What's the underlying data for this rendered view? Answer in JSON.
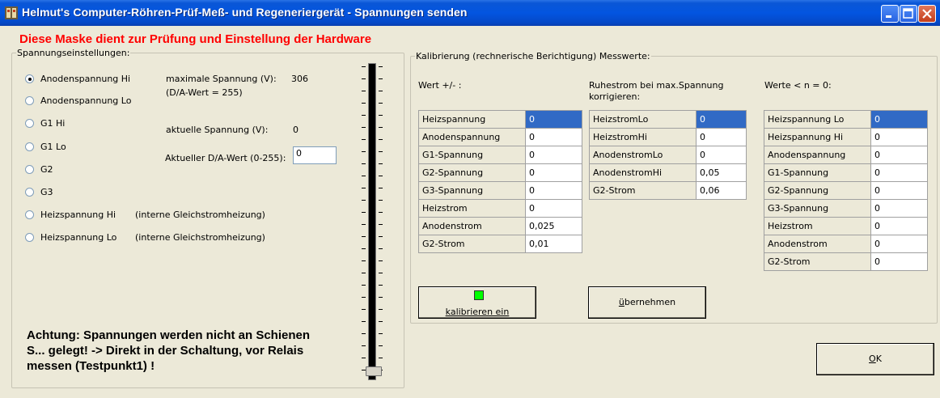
{
  "window": {
    "title": "Helmut's Computer-Röhren-Prüf-Meß- und Regeneriergerät - Spannungen senden"
  },
  "header_warning": "Diese Maske dient zur Prüfung und Einstellung der Hardware",
  "voltage_group": {
    "legend": "Spannungseinstellungen:",
    "options": [
      {
        "label": "Anodenspannung Hi",
        "selected": true
      },
      {
        "label": "Anodenspannung Lo",
        "selected": false
      },
      {
        "label": "G1 Hi",
        "selected": false
      },
      {
        "label": "G1 Lo",
        "selected": false
      },
      {
        "label": "G2",
        "selected": false
      },
      {
        "label": "G3",
        "selected": false
      },
      {
        "label": "Heizspannung Hi",
        "selected": false
      },
      {
        "label": "Heizspannung Lo",
        "selected": false
      }
    ],
    "heater_note_hi": "(interne Gleichstromheizung)",
    "heater_note_lo": "(interne Gleichstromheizung)",
    "max_voltage_label": "maximale Spannung (V):",
    "max_voltage_value": "306",
    "max_voltage_da": "(D/A-Wert = 255)",
    "current_voltage_label": "aktuelle Spannung (V):",
    "current_voltage_value": "0",
    "da_label": "Aktueller D/A-Wert (0-255):",
    "da_value": "0",
    "warning_line1": "Achtung: Spannungen werden nicht an Schienen",
    "warning_line2": "S... gelegt! -> Direkt in der Schaltung, vor Relais",
    "warning_line3": "messen (Testpunkt1) !",
    "slider_value": 0
  },
  "calibration_group": {
    "legend": "Kalibrierung (rechnerische Berichtigung) Messwerte:",
    "col1_title": "Wert +/- :",
    "col2_title_line1": "Ruhestrom bei max.Spannung",
    "col2_title_line2": "korrigieren:",
    "col3_title": "Werte < n = 0:",
    "table1": [
      {
        "name": "Heizspannung",
        "value": "0"
      },
      {
        "name": "Anodenspannung",
        "value": "0"
      },
      {
        "name": "G1-Spannung",
        "value": "0"
      },
      {
        "name": "G2-Spannung",
        "value": "0"
      },
      {
        "name": "G3-Spannung",
        "value": "0"
      },
      {
        "name": "Heizstrom",
        "value": "0"
      },
      {
        "name": "Anodenstrom",
        "value": "0,025"
      },
      {
        "name": "G2-Strom",
        "value": "0,01"
      }
    ],
    "table2": [
      {
        "name": "HeizstromLo",
        "value": "0"
      },
      {
        "name": "HeizstromHi",
        "value": "0"
      },
      {
        "name": "AnodenstromLo",
        "value": "0"
      },
      {
        "name": "AnodenstromHi",
        "value": "0,05"
      },
      {
        "name": "G2-Strom",
        "value": "0,06"
      }
    ],
    "table3": [
      {
        "name": "Heizspannung Lo",
        "value": "0"
      },
      {
        "name": "Heizspannung Hi",
        "value": "0"
      },
      {
        "name": "Anodenspannung",
        "value": "0"
      },
      {
        "name": "G1-Spannung",
        "value": "0"
      },
      {
        "name": "G2-Spannung",
        "value": "0"
      },
      {
        "name": "G3-Spannung",
        "value": "0"
      },
      {
        "name": "Heizstrom",
        "value": "0"
      },
      {
        "name": "Anodenstrom",
        "value": "0"
      },
      {
        "name": "G2-Strom",
        "value": "0"
      }
    ],
    "calibrate_button": "kalibrieren ein",
    "apply_button": "übernehmen"
  },
  "ok_button": "OK",
  "colors": {
    "led": "#00ff00",
    "selection": "#316ac5",
    "warning": "#ff0000"
  }
}
